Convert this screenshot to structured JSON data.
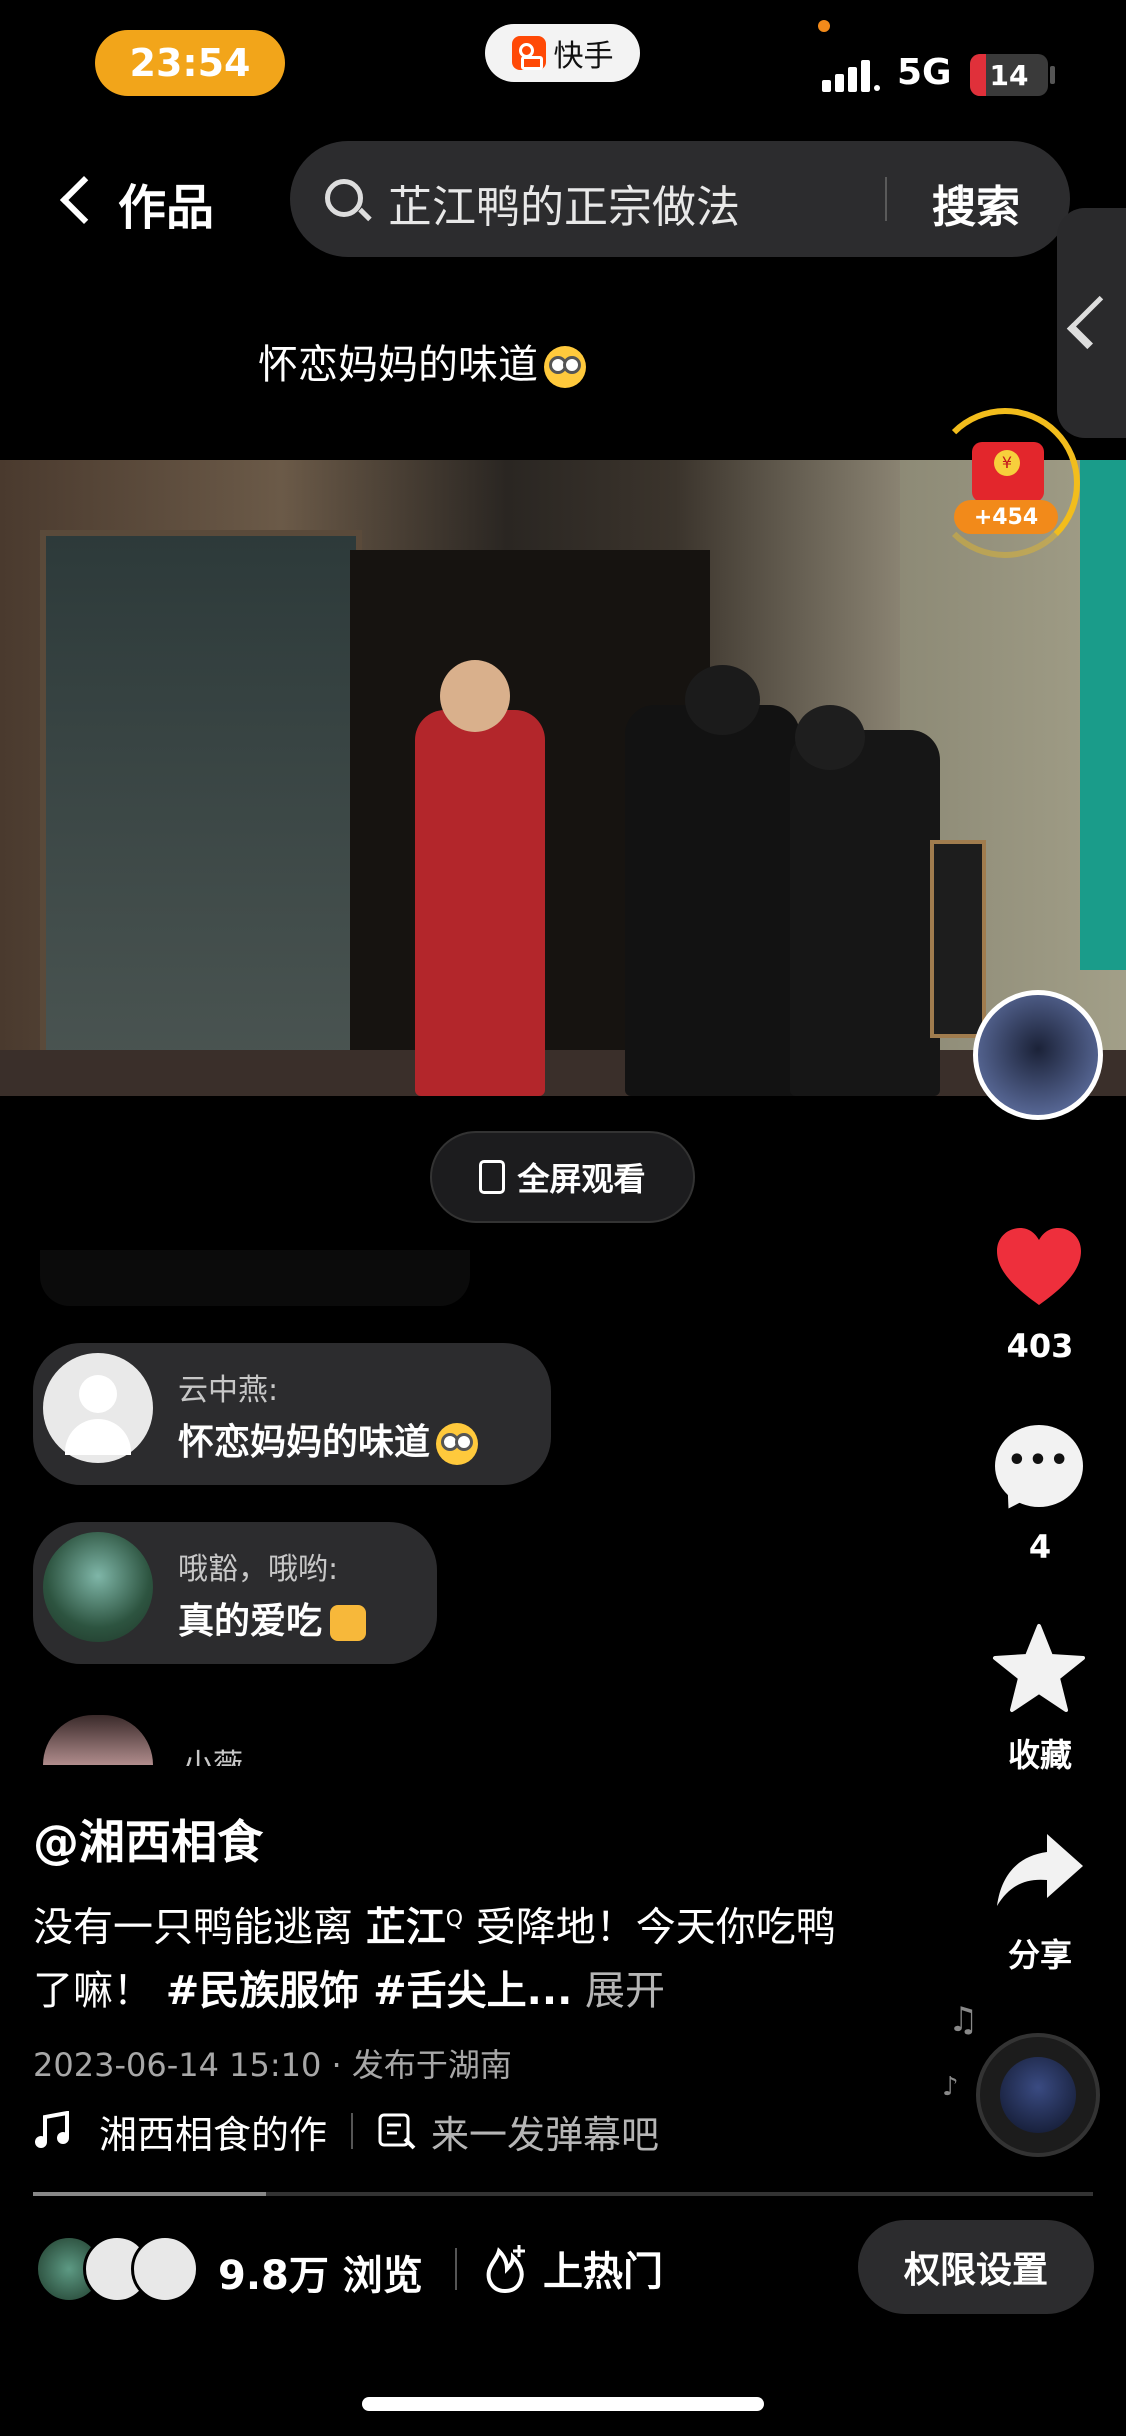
{
  "status_bar": {
    "time": "23:54",
    "app_name": "快手",
    "network": "5G",
    "battery": "14"
  },
  "header": {
    "back_label": "作品",
    "search_query": "芷江鸭的正宗做法",
    "search_button": "搜索"
  },
  "video": {
    "caption": "怀恋妈妈的味道",
    "reward_points": "+454",
    "fullscreen_label": "全屏观看"
  },
  "comments": [
    {
      "user": "云中燕:",
      "text": "怀恋妈妈的味道"
    },
    {
      "user": "哦豁，哦哟:",
      "text": "真的爱吃"
    },
    {
      "user": "小薇",
      "text": ""
    }
  ],
  "actions": {
    "likes": "403",
    "comments": "4",
    "favorite_label": "收藏",
    "share_label": "分享"
  },
  "post": {
    "author": "@湘西相食",
    "desc_part1": "没有一只鸭能逃离 ",
    "desc_link": "芷江",
    "desc_part2": " 受降地！今天你吃鸭了嘛！ ",
    "tags": "#民族服饰 #舌尖上...",
    "expand": "展开",
    "meta": "2023-06-14 15:10 · 发布于湖南",
    "music": "湘西相食的作",
    "danmaku_placeholder": "来一发弹幕吧",
    "progress": 0.22
  },
  "bottom_bar": {
    "views": "9.8万 浏览",
    "hot_label": "上热门",
    "permission_label": "权限设置"
  },
  "colors": {
    "accent_orange": "#f2a51a",
    "like_red": "#ee2f3c",
    "background": "#000000"
  }
}
